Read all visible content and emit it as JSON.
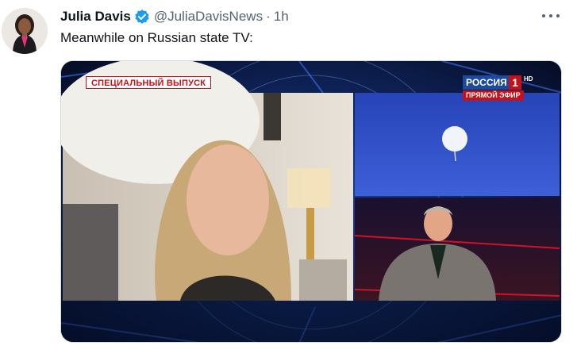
{
  "tweet": {
    "author_name": "Julia Davis",
    "handle": "@JuliaDavisNews",
    "separator": "·",
    "time": "1h",
    "text": "Meanwhile on Russian state TV:",
    "verified_icon": "verified-badge-icon",
    "more_icon": "more-options-icon"
  },
  "media": {
    "overlay_special": "СПЕЦИАЛЬНЫЙ ВЫПУСК",
    "channel_name": "РОССИЯ",
    "channel_number": "1",
    "channel_hd": "HD",
    "live_label": "ПРЯМОЙ ЭФИР"
  },
  "colors": {
    "verified_blue": "#1d9bf0",
    "secondary_text": "#536471",
    "tv_red": "#c4121c",
    "tv_blue": "#1d4a9c"
  }
}
